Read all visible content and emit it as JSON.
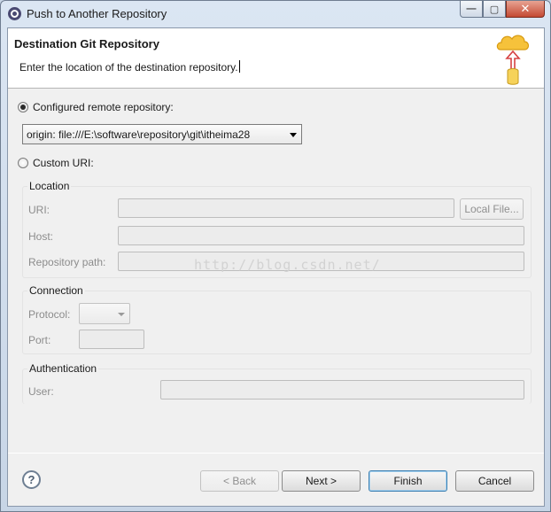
{
  "window": {
    "title": "Push to Another Repository",
    "controls": {
      "minimize": "—",
      "maximize": "▢",
      "close": "✕"
    }
  },
  "header": {
    "title": "Destination Git Repository",
    "description": "Enter the location of the destination repository.",
    "icon": "cloud-upload-database-icon"
  },
  "source": {
    "configured_label": "Configured remote repository:",
    "configured_value": "origin: file:///E:\\software\\repository\\git\\itheima28",
    "custom_label": "Custom URI:",
    "selected": "configured"
  },
  "location": {
    "title": "Location",
    "uri_label": "URI:",
    "host_label": "Host:",
    "path_label": "Repository path:",
    "local_file_button": "Local File..."
  },
  "connection": {
    "title": "Connection",
    "protocol_label": "Protocol:",
    "port_label": "Port:"
  },
  "authentication": {
    "title": "Authentication",
    "user_label": "User:"
  },
  "watermark": "http://blog.csdn.net/",
  "footer": {
    "help": "?",
    "back": "< Back",
    "next": "Next >",
    "finish": "Finish",
    "cancel": "Cancel"
  }
}
